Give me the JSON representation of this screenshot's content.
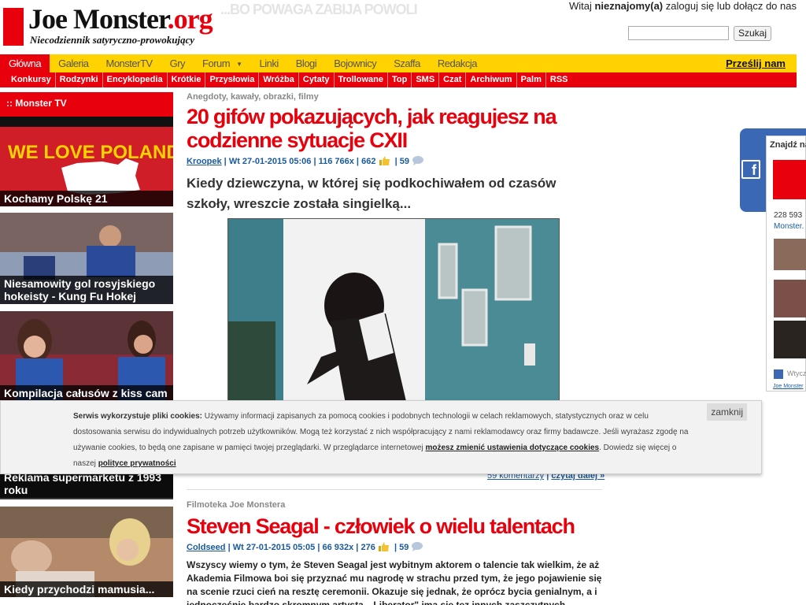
{
  "header": {
    "logo_name": "Joe Monster",
    "logo_tld": ".org",
    "tagline": "Niecodziennik satyryczno-prowokujący",
    "slogan": "...BO POWAGA ZABIJA POWOLI",
    "welcome_prefix": "Witaj",
    "welcome_user": "nieznajomy(a)",
    "welcome_suffix": "zaloguj się lub dołącz do nas",
    "search_placeholder": "",
    "search_button": "Szukaj"
  },
  "nav": {
    "primary": [
      "Główna",
      "Galeria",
      "MonsterTV",
      "Gry",
      "Forum",
      "Linki",
      "Blogi",
      "Bojownicy",
      "Szaffa",
      "Redakcja"
    ],
    "send_label": "Prześlij nam",
    "secondary": [
      "Konkursy",
      "Rodzynki",
      "Encyklopedia",
      "Krótkie",
      "Przysłowia",
      "Wróżba",
      "Cytaty",
      "Trollowane",
      "Top",
      "SMS",
      "Czat",
      "Archiwum",
      "Palm",
      "RSS"
    ]
  },
  "sidebar": {
    "title": ":: Monster TV",
    "tiles": [
      {
        "caption": "Kochamy Polskę 21",
        "banner": "WE LOVE POLAND"
      },
      {
        "caption": "Niesamowity gol rosyjskiego hokeisty - Kung Fu Hokej"
      },
      {
        "caption": "Kompilacja całusów z kiss cam"
      },
      {
        "caption": "Reklama supermarketu z 1993 roku"
      },
      {
        "caption": "Kiedy przychodzi mamusia..."
      }
    ]
  },
  "articles": [
    {
      "category": "Anegdoty, kawały, obrazki, filmy",
      "title": "20 gifów pokazujących, jak reagujesz na codzienne sytuacje CXII",
      "author": "Kroopek",
      "date": "Wt 27-01-2015 05:06",
      "views": "116 766x",
      "likes": "662",
      "comments": "59",
      "lead": "Kiedy dziewczyna, w której się podkochiwałem od czasów szkoły, wreszcie została singielką...",
      "comments_link": "59 komentarzy",
      "read_more": "czytaj dalej »"
    },
    {
      "category": "Filmoteka Joe Monstera",
      "title": "Steven Seagal - człowiek o wielu talentach",
      "author": "Coldseed",
      "date": "Wt 27-01-2015 05:05",
      "views": "66 932x",
      "likes": "276",
      "comments": "59",
      "lead": "Wszyscy wiemy o tym, że Steven Seagal jest wybitnym aktorem o talencie tak wielkim, że aż Akademia Filmowa boi się przyznać mu nagrodę w strachu przed tym, że jego pojawienie się na scenie rzuci cień na resztę ceremonii. Okazuje się jednak, że oprócz bycia genialnym, a i jednocześnie bardzo skromnym artystą, „Liberator\" ima się tez innych zaszczytnych zawodów."
    }
  ],
  "fb_panel": {
    "title": "Znajdź na",
    "count": "228 593",
    "monster": "Monster.",
    "share": "Wtycz",
    "footer": "Joe Monster"
  },
  "cookie": {
    "bold": "Serwis wykorzystuje pliki cookies:",
    "text1": "Używamy informacji zapisanych za pomocą cookies i podobnych technologii w celach reklamowych, statystycznych oraz w celu dostosowania serwisu do indywidualnych potrzeb użytkowników. Mogą też korzystać z nich współpracujący z nami reklamodawcy oraz firmy badawcze. Jeśli wyrażasz zgodę na używanie cookies, to będą one zapisane w pamięci twojej przeglądarki. W przeglądarce internetowej",
    "link1": "możesz zmienić ustawienia dotyczące cookies",
    "text2": ". Dowiedz się więcej o naszej",
    "link2": "polityce prywatności",
    "close": "zamknij"
  },
  "colors": {
    "brand_red": "#e8000d",
    "nav_yellow": "#ffd200",
    "facebook_blue": "#3b68b5"
  }
}
